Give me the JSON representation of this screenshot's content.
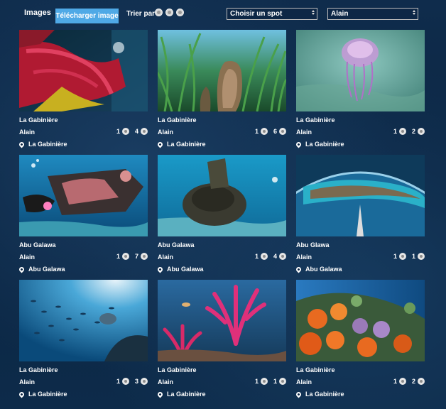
{
  "toolbar": {
    "title": "Images",
    "upload_label": "Télécharger image",
    "sort_label": "Trier par",
    "spot_select_value": "Choisir un spot",
    "user_select_value": "Alain"
  },
  "cards": [
    {
      "title": "La Gabinière",
      "author": "Alain",
      "stat1": "1",
      "stat2": "4",
      "location": "La Gabinière",
      "image": "red-gorgonian-photo"
    },
    {
      "title": "La Gabinière",
      "author": "Alain",
      "stat1": "1",
      "stat2": "6",
      "location": "La Gabinière",
      "image": "seagrass-pinna-photo"
    },
    {
      "title": "La Gabinière",
      "author": "Alain",
      "stat1": "1",
      "stat2": "2",
      "location": "La Gabinière",
      "image": "jellyfish-photo"
    },
    {
      "title": "Abu Galawa",
      "author": "Alain",
      "stat1": "1",
      "stat2": "7",
      "location": "Abu Galawa",
      "image": "diver-wreck-photo"
    },
    {
      "title": "Abu Galawa",
      "author": "Alain",
      "stat1": "1",
      "stat2": "4",
      "location": "Abu Galawa",
      "image": "wreck-boiler-photo"
    },
    {
      "title": "Abu Glawa",
      "author": "Alain",
      "stat1": "1",
      "stat2": "1",
      "location": "Abu Galawa",
      "image": "reef-fisheye-photo"
    },
    {
      "title": "La Gabinière",
      "author": "Alain",
      "stat1": "1",
      "stat2": "3",
      "location": "La Gabinière",
      "image": "fish-school-photo"
    },
    {
      "title": "La Gabinière",
      "author": "Alain",
      "stat1": "1",
      "stat2": "1",
      "location": "La Gabinière",
      "image": "pink-gorgonian-photo"
    },
    {
      "title": "La Gabinière",
      "author": "Alain",
      "stat1": "1",
      "stat2": "2",
      "location": "La Gabinière",
      "image": "orange-coral-photo"
    }
  ]
}
